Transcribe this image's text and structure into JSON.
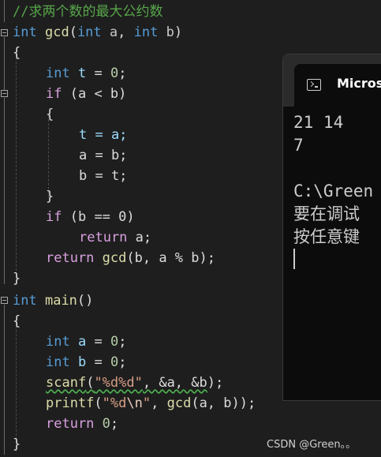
{
  "code": {
    "comment": "//求两个数的最大公约数",
    "gcd_params": {
      "t1": "int",
      "n1": "a",
      "t2": "int",
      "n2": "b"
    },
    "gcd_name": "gcd",
    "decl_type": "int",
    "t_decl_var": "t",
    "if_kw": "if",
    "if_cond": "(a < b)",
    "assign_t": "t = a;",
    "assign_a": "a = b;",
    "assign_b": "b = t;",
    "if2_cond": "(b == 0)",
    "return_kw": "return",
    "return_a": " a;",
    "recursive_call": "gcd",
    "recursive_args": "(b, a % b);",
    "main_name": "main",
    "main_parens": "()",
    "decl_a": "a",
    "decl_b": "b",
    "scanf_name": "scanf",
    "scanf_format": "\"%d%d\"",
    "scanf_args": ", &a, &b",
    "printf_name": "printf",
    "printf_format_a": "\"%d",
    "printf_escape": "\\n",
    "printf_format_b": "\"",
    "printf_mid": ", ",
    "printf_args": "(a, b));",
    "return0_value": "0",
    "zero": "0"
  },
  "console": {
    "tab_title": "Microsoft Visual Studio Debug Console",
    "lines": [
      "21 14",
      "7",
      "",
      "C:\\Green",
      "要在调试",
      "按任意键"
    ]
  },
  "watermark": "CSDN @Green。。",
  "colors": {
    "background": "#1e1e1e",
    "keyword": "#569cd6",
    "function": "#dcdcaa",
    "comment": "#57a64a",
    "string": "#d69d85",
    "number": "#b5cea8",
    "control": "#d8a0df",
    "console_bg": "#0c0c0c"
  },
  "icons": {
    "console_tab": "terminal-icon",
    "fold": "collapse-icon"
  }
}
